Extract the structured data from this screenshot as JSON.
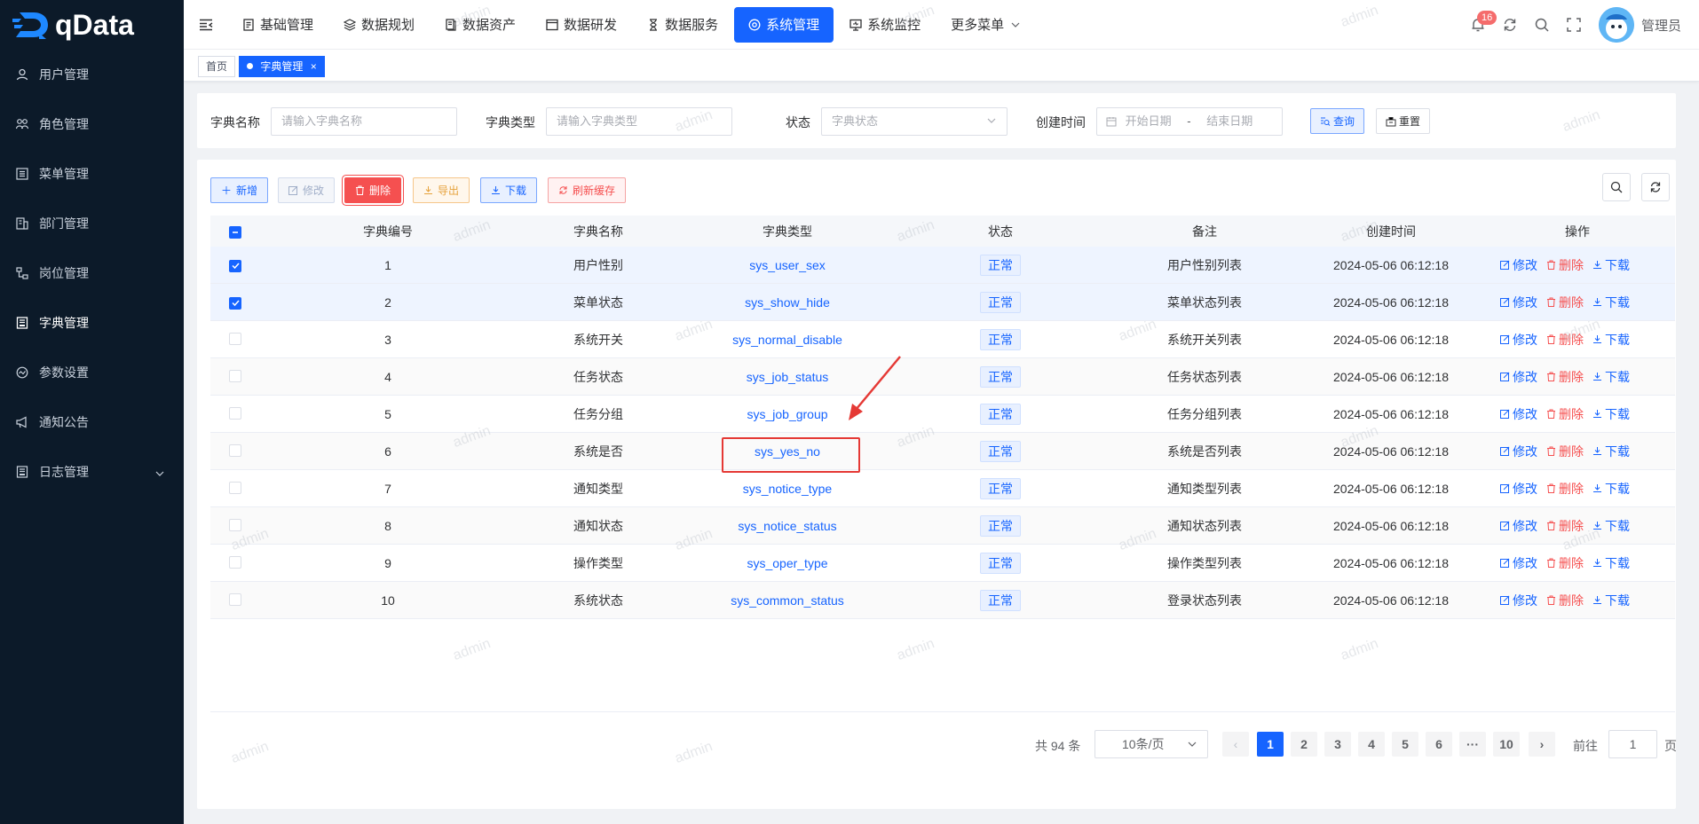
{
  "app": {
    "logo_text": "qData"
  },
  "sidebar": {
    "items": [
      {
        "label": "用户管理",
        "icon": "user-icon"
      },
      {
        "label": "角色管理",
        "icon": "role-icon"
      },
      {
        "label": "菜单管理",
        "icon": "menu-list-icon"
      },
      {
        "label": "部门管理",
        "icon": "department-icon"
      },
      {
        "label": "岗位管理",
        "icon": "post-icon"
      },
      {
        "label": "字典管理",
        "icon": "dictionary-icon",
        "active": true
      },
      {
        "label": "参数设置",
        "icon": "settings-icon"
      },
      {
        "label": "通知公告",
        "icon": "megaphone-icon"
      },
      {
        "label": "日志管理",
        "icon": "log-icon",
        "expandable": true
      }
    ]
  },
  "topnav": {
    "items": [
      {
        "label": "基础管理"
      },
      {
        "label": "数据规划"
      },
      {
        "label": "数据资产"
      },
      {
        "label": "数据研发"
      },
      {
        "label": "数据服务"
      },
      {
        "label": "系统管理",
        "active": true
      },
      {
        "label": "系统监控"
      },
      {
        "label": "更多菜单"
      }
    ],
    "notification_count": "16",
    "username": "管理员"
  },
  "tags": [
    {
      "label": "首页"
    },
    {
      "label": "字典管理",
      "active": true
    }
  ],
  "search": {
    "name_label": "字典名称",
    "name_placeholder": "请输入字典名称",
    "type_label": "字典类型",
    "type_placeholder": "请输入字典类型",
    "status_label": "状态",
    "status_placeholder": "字典状态",
    "time_label": "创建时间",
    "start_placeholder": "开始日期",
    "range_sep": "-",
    "end_placeholder": "结束日期",
    "query_label": "查询",
    "reset_label": "重置"
  },
  "toolbar": {
    "add": "新增",
    "edit": "修改",
    "delete": "删除",
    "export": "导出",
    "download": "下载",
    "refresh_cache": "刷新缓存"
  },
  "table": {
    "columns": [
      "字典编号",
      "字典名称",
      "字典类型",
      "状态",
      "备注",
      "创建时间",
      "操作"
    ],
    "op_labels": {
      "edit": "修改",
      "delete": "删除",
      "download": "下载"
    },
    "rows": [
      {
        "id": "1",
        "name": "用户性别",
        "type": "sys_user_sex",
        "status": "正常",
        "remark": "用户性别列表",
        "time": "2024-05-06 06:12:18",
        "checked": true
      },
      {
        "id": "2",
        "name": "菜单状态",
        "type": "sys_show_hide",
        "status": "正常",
        "remark": "菜单状态列表",
        "time": "2024-05-06 06:12:18",
        "checked": true
      },
      {
        "id": "3",
        "name": "系统开关",
        "type": "sys_normal_disable",
        "status": "正常",
        "remark": "系统开关列表",
        "time": "2024-05-06 06:12:18",
        "checked": false
      },
      {
        "id": "4",
        "name": "任务状态",
        "type": "sys_job_status",
        "status": "正常",
        "remark": "任务状态列表",
        "time": "2024-05-06 06:12:18",
        "checked": false
      },
      {
        "id": "5",
        "name": "任务分组",
        "type": "sys_job_group",
        "status": "正常",
        "remark": "任务分组列表",
        "time": "2024-05-06 06:12:18",
        "checked": false
      },
      {
        "id": "6",
        "name": "系统是否",
        "type": "sys_yes_no",
        "status": "正常",
        "remark": "系统是否列表",
        "time": "2024-05-06 06:12:18",
        "checked": false
      },
      {
        "id": "7",
        "name": "通知类型",
        "type": "sys_notice_type",
        "status": "正常",
        "remark": "通知类型列表",
        "time": "2024-05-06 06:12:18",
        "checked": false
      },
      {
        "id": "8",
        "name": "通知状态",
        "type": "sys_notice_status",
        "status": "正常",
        "remark": "通知状态列表",
        "time": "2024-05-06 06:12:18",
        "checked": false
      },
      {
        "id": "9",
        "name": "操作类型",
        "type": "sys_oper_type",
        "status": "正常",
        "remark": "操作类型列表",
        "time": "2024-05-06 06:12:18",
        "checked": false
      },
      {
        "id": "10",
        "name": "系统状态",
        "type": "sys_common_status",
        "status": "正常",
        "remark": "登录状态列表",
        "time": "2024-05-06 06:12:18",
        "checked": false
      }
    ]
  },
  "pager": {
    "total": "共 94 条",
    "page_size": "10条/页",
    "pages": [
      "1",
      "2",
      "3",
      "4",
      "5",
      "6",
      "···",
      "10"
    ],
    "current": "1",
    "goto_label": "前往",
    "goto_value": "1",
    "page_suffix": "页"
  },
  "watermark_text": "admin",
  "colors": {
    "primary": "#1664ff",
    "danger": "#f55050",
    "sidebar_bg": "#0c1a29"
  }
}
